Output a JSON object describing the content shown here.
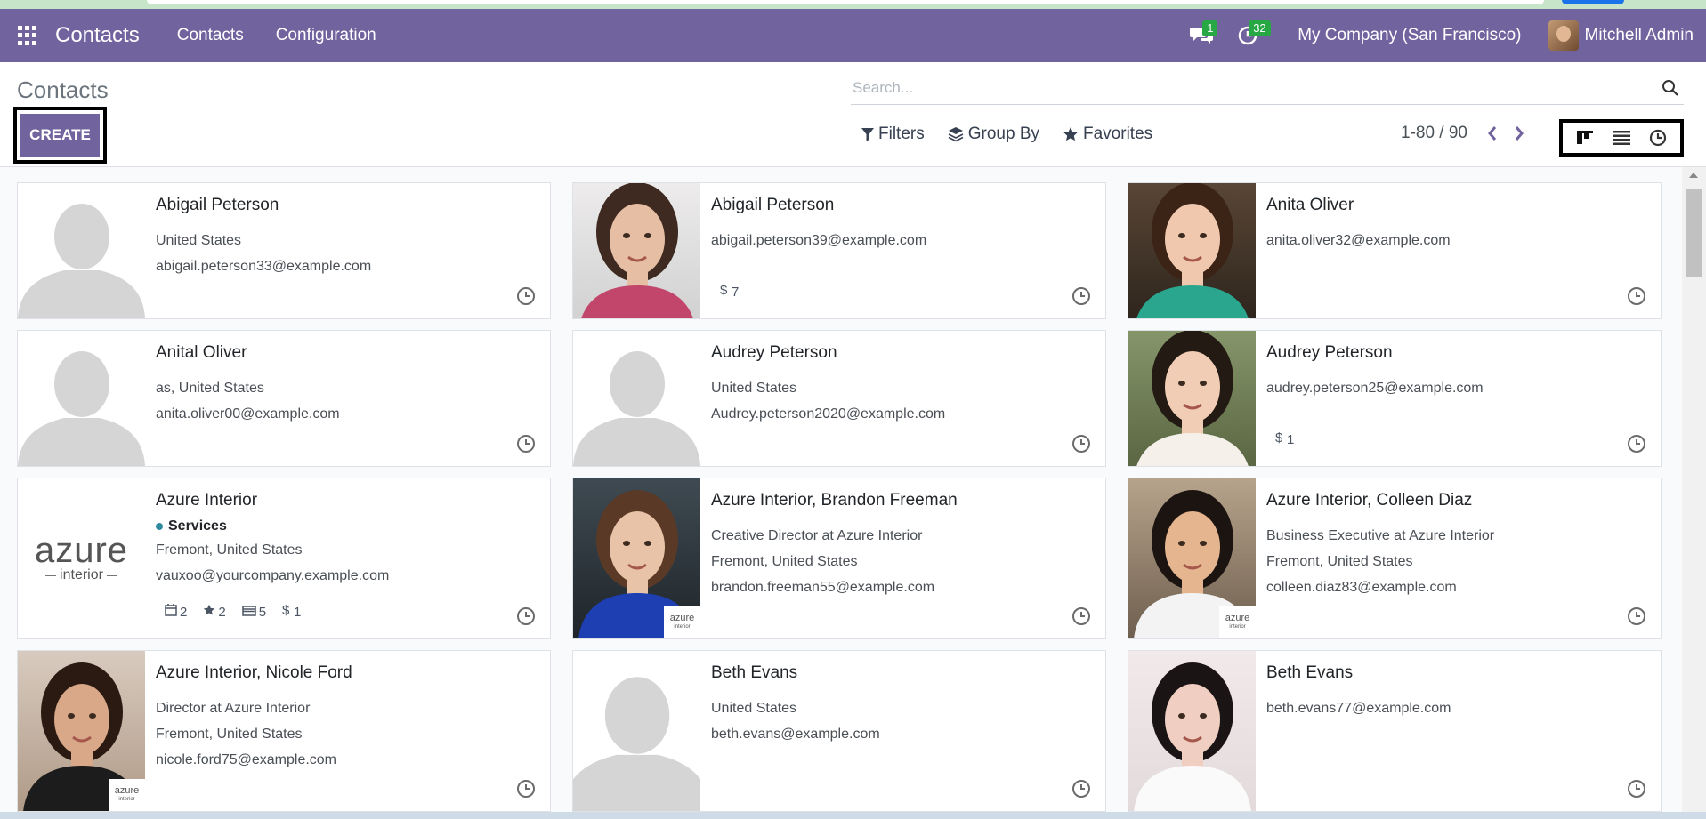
{
  "navbar": {
    "brand": "Contacts",
    "menu": [
      "Contacts",
      "Configuration"
    ],
    "messages_count": "1",
    "activities_count": "32",
    "company": "My Company (San Francisco)",
    "user": "Mitchell Admin",
    "color": "#71639e"
  },
  "control_panel": {
    "title": "Contacts",
    "create_label": "CREATE",
    "search_placeholder": "Search...",
    "filters_label": "Filters",
    "group_by_label": "Group By",
    "favorites_label": "Favorites",
    "pager": "1-80 / 90"
  },
  "cards": [
    {
      "name": "Abigail Peterson",
      "lines": [
        "United States",
        "abigail.peterson33@example.com"
      ],
      "image": "silhouette"
    },
    {
      "name": "Abigail Peterson",
      "lines": [
        "abigail.peterson39@example.com"
      ],
      "image": "photo-curly",
      "stats": [
        {
          "icon": "dollar-icon",
          "value": "7"
        }
      ]
    },
    {
      "name": "Anita Oliver",
      "lines": [
        "anita.oliver32@example.com"
      ],
      "image": "photo-brunette"
    },
    {
      "name": "Anital Oliver",
      "lines": [
        "as, United States",
        "anita.oliver00@example.com"
      ],
      "image": "silhouette"
    },
    {
      "name": "Audrey Peterson",
      "lines": [
        "United States",
        "Audrey.peterson2020@example.com"
      ],
      "image": "silhouette"
    },
    {
      "name": "Audrey Peterson",
      "lines": [
        "audrey.peterson25@example.com"
      ],
      "image": "photo-outdoor",
      "stats": [
        {
          "icon": "dollar-icon",
          "value": "1"
        }
      ]
    },
    {
      "name": "Azure Interior",
      "tag": "Services",
      "lines": [
        "Fremont, United States",
        "vauxoo@yourcompany.example.com"
      ],
      "image": "azure-logo",
      "stats": [
        {
          "icon": "calendar-icon",
          "value": "2"
        },
        {
          "icon": "star-icon",
          "value": "2"
        },
        {
          "icon": "credit-card-icon",
          "value": "5"
        },
        {
          "icon": "dollar-icon",
          "value": "1"
        }
      ]
    },
    {
      "name": "Azure Interior, Brandon Freeman",
      "lines": [
        "Creative Director at Azure Interior",
        "Fremont, United States",
        "brandon.freeman55@example.com"
      ],
      "image": "photo-young-man",
      "company_logo": "azure"
    },
    {
      "name": "Azure Interior, Colleen Diaz",
      "lines": [
        "Business Executive at Azure Interior",
        "Fremont, United States",
        "colleen.diaz83@example.com"
      ],
      "image": "photo-smiling",
      "company_logo": "azure"
    },
    {
      "name": "Azure Interior, Nicole Ford",
      "lines": [
        "Director at Azure Interior",
        "Fremont, United States",
        "nicole.ford75@example.com"
      ],
      "image": "photo-dark-hair",
      "company_logo": "azure"
    },
    {
      "name": "Beth Evans",
      "lines": [
        "United States",
        "beth.evans@example.com"
      ],
      "image": "silhouette"
    },
    {
      "name": "Beth Evans",
      "lines": [
        "beth.evans77@example.com"
      ],
      "image": "photo-light"
    }
  ],
  "logo_text": {
    "azure_big": "azure",
    "azure_sub": "interior",
    "mini": "azure",
    "mini_sub": "interior"
  }
}
